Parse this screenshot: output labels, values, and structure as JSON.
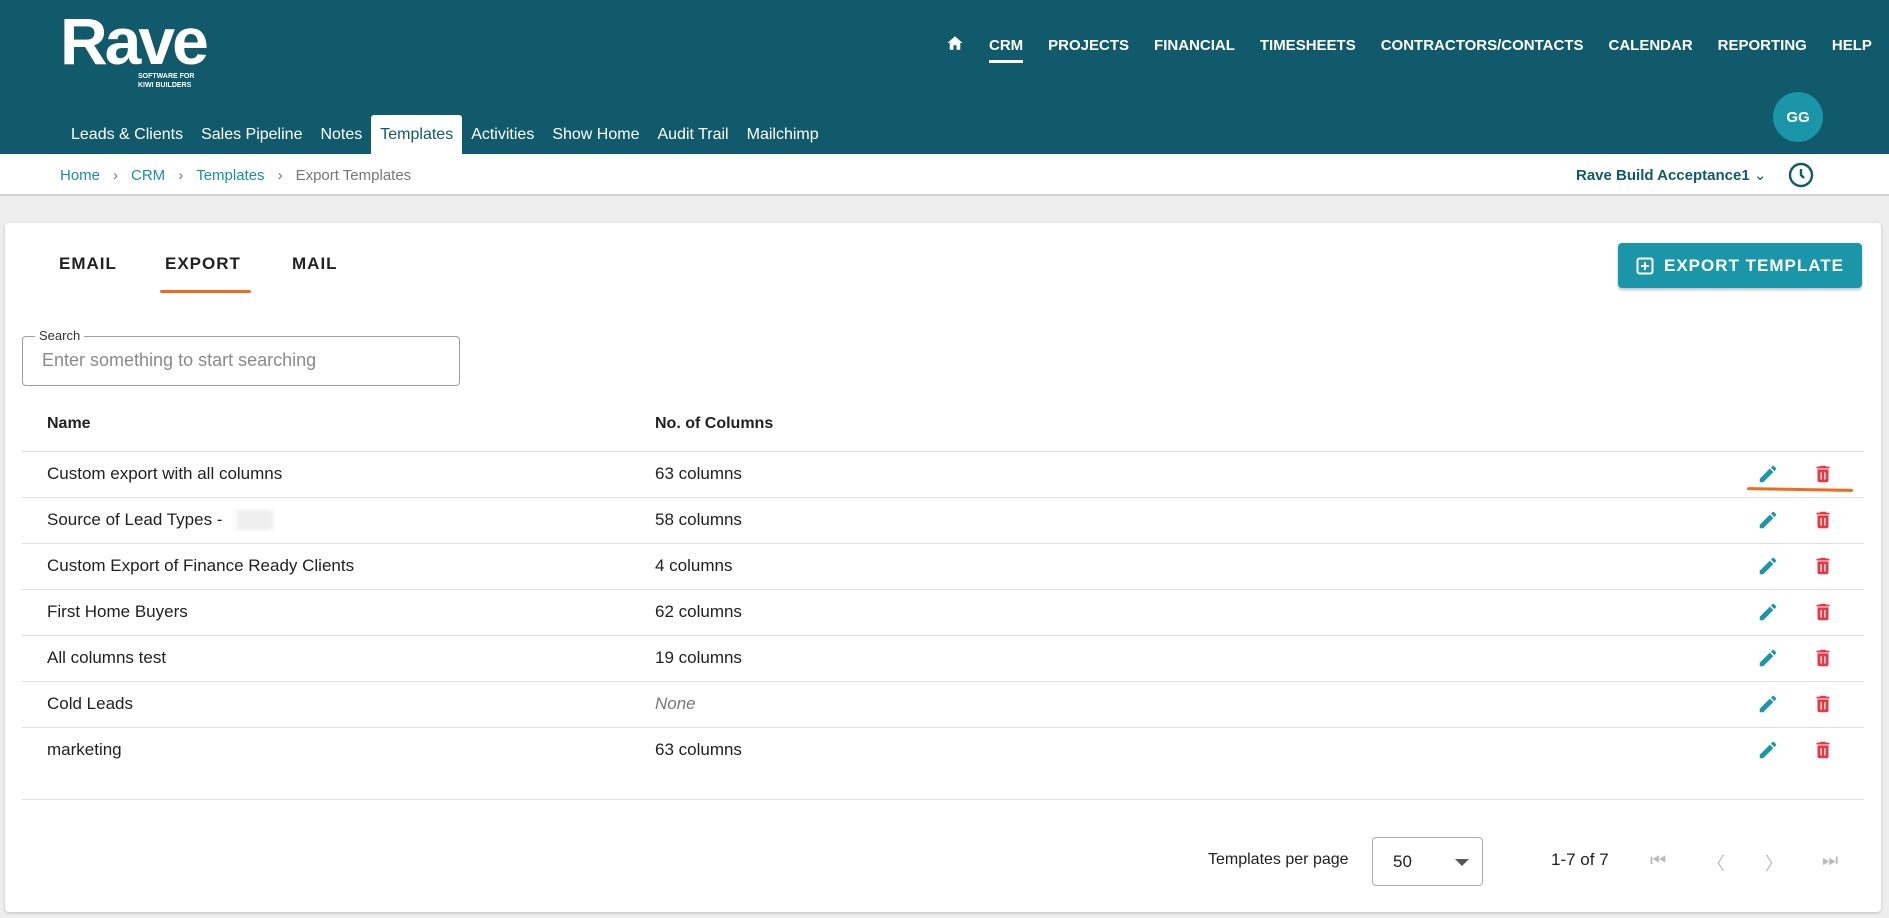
{
  "logo": {
    "name": "Rave",
    "tagline": "SOFTWARE FOR\nKIWI BUILDERS"
  },
  "top_nav": [
    "CRM",
    "PROJECTS",
    "FINANCIAL",
    "TIMESHEETS",
    "CONTRACTORS/CONTACTS",
    "CALENDAR",
    "REPORTING",
    "HELP"
  ],
  "sub_nav": [
    "Leads & Clients",
    "Sales Pipeline",
    "Notes",
    "Templates",
    "Activities",
    "Show Home",
    "Audit Trail",
    "Mailchimp"
  ],
  "user": {
    "initials": "GG"
  },
  "breadcrumb": [
    "Home",
    "CRM",
    "Templates",
    "Export Templates"
  ],
  "organization": "Rave Build Acceptance1",
  "tabs": [
    "EMAIL",
    "EXPORT",
    "MAIL"
  ],
  "export_button": "EXPORT TEMPLATE",
  "search": {
    "label": "Search",
    "placeholder": "Enter something to start searching"
  },
  "columns": {
    "name": "Name",
    "count": "No. of Columns"
  },
  "rows": [
    {
      "name": "Custom export with all columns",
      "count": "63 columns"
    },
    {
      "name": "Source of Lead Types -",
      "count": "58 columns"
    },
    {
      "name": "Custom Export of Finance Ready Clients",
      "count": "4 columns"
    },
    {
      "name": "First Home Buyers",
      "count": "62 columns"
    },
    {
      "name": "All columns test",
      "count": "19 columns"
    },
    {
      "name": "Cold Leads",
      "count": "None"
    },
    {
      "name": "marketing",
      "count": "63 columns"
    }
  ],
  "pagination": {
    "per_page_label": "Templates per page",
    "per_page": "50",
    "range": "1-7 of 7"
  },
  "colors": {
    "header": "#115a6c",
    "accent": "#1b96a8",
    "delete": "#e53945",
    "underline": "#f26b1d"
  }
}
